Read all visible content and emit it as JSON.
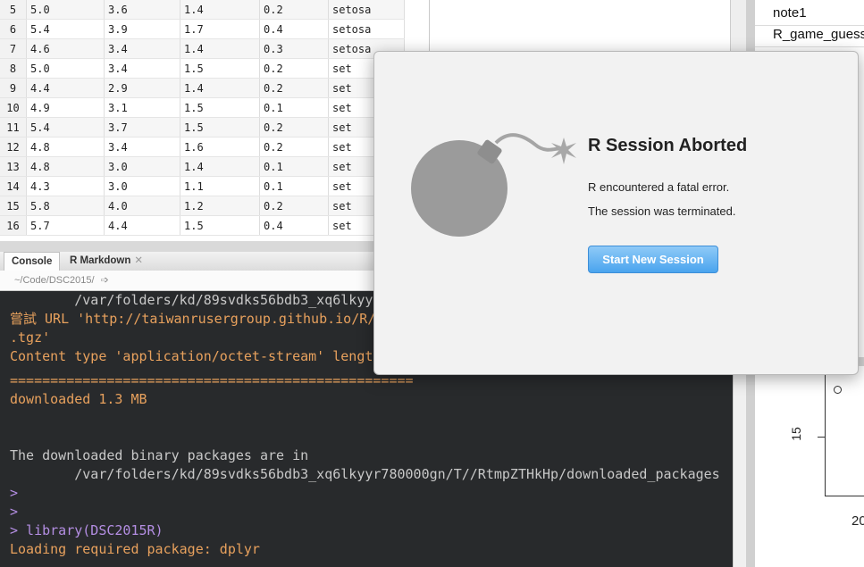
{
  "dataview": {
    "rows": [
      [
        "5",
        "5.0",
        "3.6",
        "1.4",
        "0.2",
        "setosa"
      ],
      [
        "6",
        "5.4",
        "3.9",
        "1.7",
        "0.4",
        "setosa"
      ],
      [
        "7",
        "4.6",
        "3.4",
        "1.4",
        "0.3",
        "setosa"
      ],
      [
        "8",
        "5.0",
        "3.4",
        "1.5",
        "0.2",
        "set"
      ],
      [
        "9",
        "4.4",
        "2.9",
        "1.4",
        "0.2",
        "set"
      ],
      [
        "10",
        "4.9",
        "3.1",
        "1.5",
        "0.1",
        "set"
      ],
      [
        "11",
        "5.4",
        "3.7",
        "1.5",
        "0.2",
        "set"
      ],
      [
        "12",
        "4.8",
        "3.4",
        "1.6",
        "0.2",
        "set"
      ],
      [
        "13",
        "4.8",
        "3.0",
        "1.4",
        "0.1",
        "set"
      ],
      [
        "14",
        "4.3",
        "3.0",
        "1.1",
        "0.1",
        "set"
      ],
      [
        "15",
        "5.8",
        "4.0",
        "1.2",
        "0.2",
        "set"
      ],
      [
        "16",
        "5.7",
        "4.4",
        "1.5",
        "0.4",
        "set"
      ]
    ]
  },
  "console": {
    "tabs": [
      "Console",
      "R Markdown"
    ],
    "path": "~/Code/DSC2015/",
    "lines": [
      {
        "cls": "wh",
        "text": "        /var/folders/kd/89svdks56bdb3_xq6lkyy"
      },
      {
        "cls": "or",
        "text": "嘗試 URL 'http://taiwanrusergroup.github.io/R/"
      },
      {
        "cls": "or",
        "text": ".tgz'"
      },
      {
        "cls": "or",
        "text": "Content type 'application/octet-stream' lengt"
      },
      {
        "cls": "or",
        "text": "=================================================="
      },
      {
        "cls": "or",
        "text": "downloaded 1.3 MB"
      },
      {
        "cls": "wh",
        "text": ""
      },
      {
        "cls": "wh",
        "text": ""
      },
      {
        "cls": "wh",
        "text": "The downloaded binary packages are in"
      },
      {
        "cls": "wh",
        "text": "        /var/folders/kd/89svdks56bdb3_xq6lkyyr780000gn/T//RtmpZTHkHp/downloaded_packages"
      },
      {
        "cls": "pu",
        "text": ">"
      },
      {
        "cls": "pu",
        "text": ">"
      },
      {
        "cls": "pu",
        "text": "> library(DSC2015R)"
      },
      {
        "cls": "or",
        "text": "Loading required package: dplyr"
      }
    ]
  },
  "right_pane": {
    "items": [
      "note1",
      "R_game_guess",
      ""
    ],
    "plot": {
      "ytick": "15",
      "xtick": "20"
    }
  },
  "modal": {
    "title": "R Session Aborted",
    "message1": "R encountered a fatal error.",
    "message2": "The session was terminated.",
    "button": "Start New Session",
    "icon": "bomb-icon"
  }
}
